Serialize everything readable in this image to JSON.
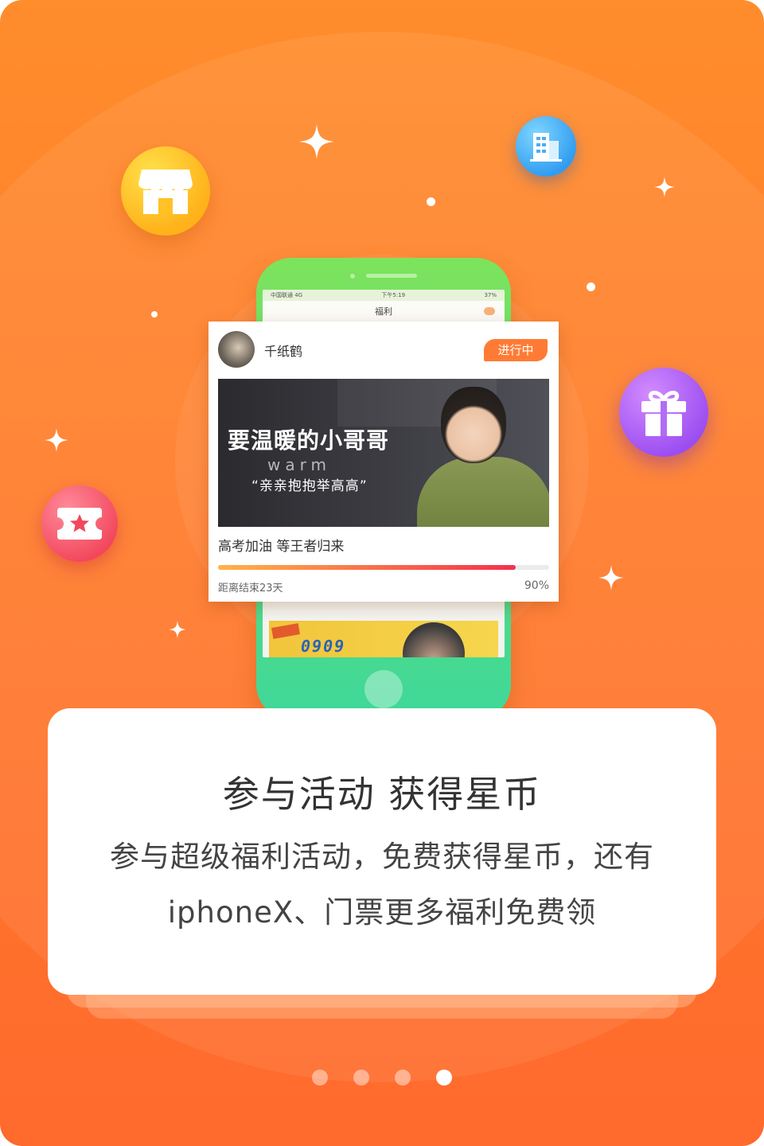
{
  "phone_screen": {
    "status_left": "中国联通 4G",
    "status_time": "下午5:19",
    "status_right": "37%",
    "app_title": "福利",
    "thumb_text": "0909"
  },
  "card": {
    "user_name": "千纸鹤",
    "status_tag": "进行中",
    "banner": {
      "title": "要温暖的小哥哥",
      "warm": "warm",
      "subtitle": "亲亲抱抱举高高"
    },
    "caption": "高考加油 等王者归来",
    "progress": {
      "remaining": "距离结束23天",
      "percent_label": "90%",
      "fraction": 0.9
    }
  },
  "panel": {
    "title": "参与活动 获得星币",
    "line1": "参与超级福利活动，免费获得星币，还有",
    "line2": "iphoneX、门票更多福利免费领"
  },
  "icons": [
    "store-icon",
    "building-icon",
    "gift-icon",
    "ticket-icon",
    "sparkle-icon"
  ],
  "colors": {
    "background": "#ff7b2b",
    "accent": "#ff7b35",
    "phone": "#5ddc76",
    "progress_start": "#ffb347",
    "progress_end": "#f5304d"
  },
  "pager": {
    "count": 4,
    "active_index": 3
  }
}
